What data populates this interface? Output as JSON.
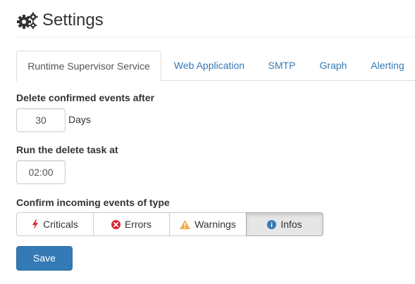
{
  "header": {
    "title": "Settings",
    "icon": "gears-icon"
  },
  "tabs": [
    {
      "label": "Runtime Supervisor Service",
      "active": true
    },
    {
      "label": "Web Application"
    },
    {
      "label": "SMTP"
    },
    {
      "label": "Graph"
    },
    {
      "label": "Alerting"
    }
  ],
  "form": {
    "delete_after_label": "Delete confirmed events after",
    "delete_after_value": "30",
    "delete_after_unit": "Days",
    "run_at_label": "Run the delete task at",
    "run_at_value": "02:00",
    "confirm_label": "Confirm incoming events of type",
    "event_types": [
      {
        "label": "Criticals",
        "icon": "bolt-icon",
        "color": "#e8242b"
      },
      {
        "label": "Errors",
        "icon": "error-circle-icon",
        "color": "#d9262c"
      },
      {
        "label": "Warnings",
        "icon": "warning-triangle-icon",
        "color": "#f0ad4e"
      },
      {
        "label": "Infos",
        "icon": "info-circle-icon",
        "color": "#337ab7",
        "active": true
      }
    ],
    "save_label": "Save"
  },
  "colors": {
    "primary": "#337ab7",
    "link": "#337ab7"
  }
}
